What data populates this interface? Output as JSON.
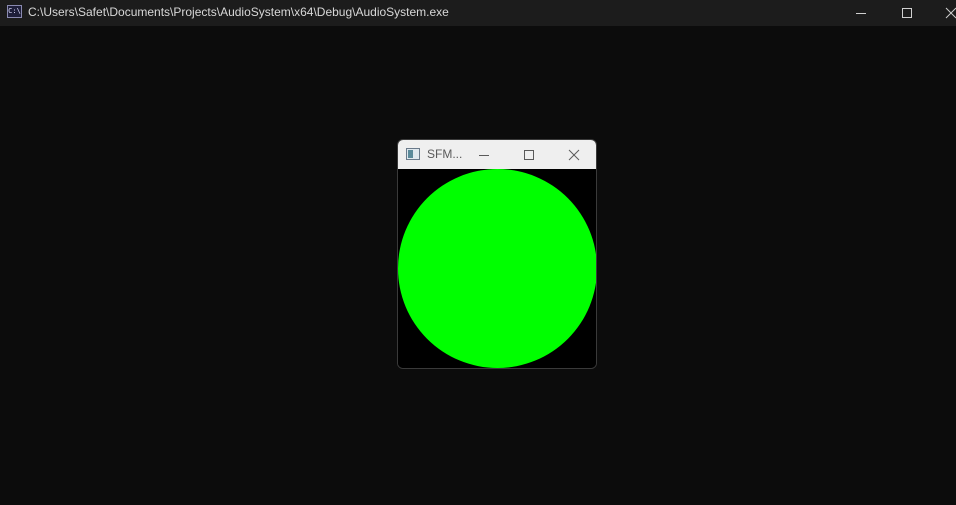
{
  "console": {
    "title": "C:\\Users\\Safet\\Documents\\Projects\\AudioSystem\\x64\\Debug\\AudioSystem.exe",
    "icon": "console-app-icon",
    "icon_glyph": "C:\\",
    "background_color": "#0c0c0c",
    "controls": {
      "minimize": "minimize-icon",
      "maximize": "maximize-icon",
      "close": "close-icon"
    }
  },
  "sfml_window": {
    "title": "SFM...",
    "icon": "sfml-app-icon",
    "background_color": "#000000",
    "controls": {
      "minimize": "minimize-icon",
      "maximize": "maximize-icon",
      "close": "close-icon"
    },
    "shape": {
      "type": "circle",
      "fill_color": "#00ff00"
    }
  }
}
